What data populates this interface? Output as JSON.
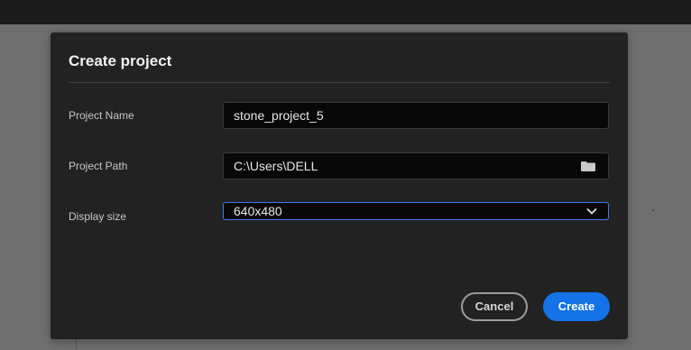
{
  "dialog": {
    "title": "Create project",
    "fields": {
      "project_name": {
        "label": "Project Name",
        "value": "stone_project_5"
      },
      "project_path": {
        "label": "Project Path",
        "value": "C:\\Users\\DELL",
        "icon": "folder-icon"
      },
      "display_size": {
        "label": "Display size",
        "value": "640x480",
        "icon": "chevron-down-icon"
      }
    },
    "buttons": {
      "cancel": "Cancel",
      "create": "Create"
    }
  },
  "colors": {
    "accent": "#1473e6",
    "dialog_bg": "#222222",
    "backdrop": "#6f6f6f"
  }
}
